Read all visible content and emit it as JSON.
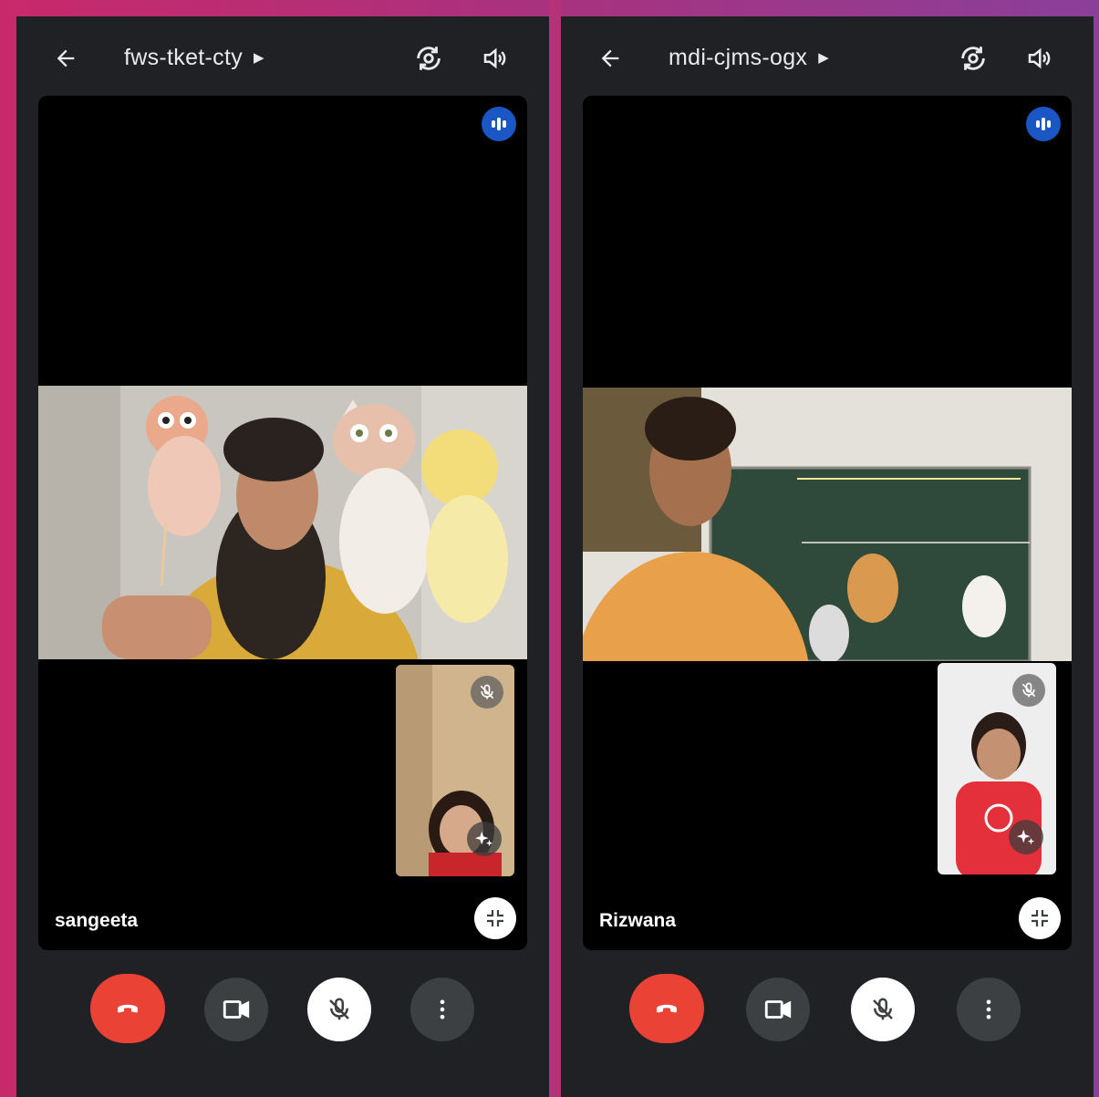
{
  "calls": [
    {
      "meeting_code": "fws-tket-cty",
      "main_participant": "sangeeta"
    },
    {
      "meeting_code": "mdi-cjms-ogx",
      "main_participant": "Rizwana"
    }
  ],
  "icons": {
    "back": "arrow-left-icon",
    "switch_camera": "camera-switch-icon",
    "speaker": "speaker-icon",
    "speaking": "audio-level-icon",
    "pip_muted": "mic-off-icon",
    "effects": "sparkles-icon",
    "shrink": "minimize-icon",
    "end_call": "phone-hangup-icon",
    "camera": "videocam-icon",
    "mic": "mic-off-icon",
    "more": "more-vert-icon"
  },
  "colors": {
    "end_call": "#ea4335",
    "speaking_badge": "#1a56c4",
    "frame": "#c9296b"
  }
}
